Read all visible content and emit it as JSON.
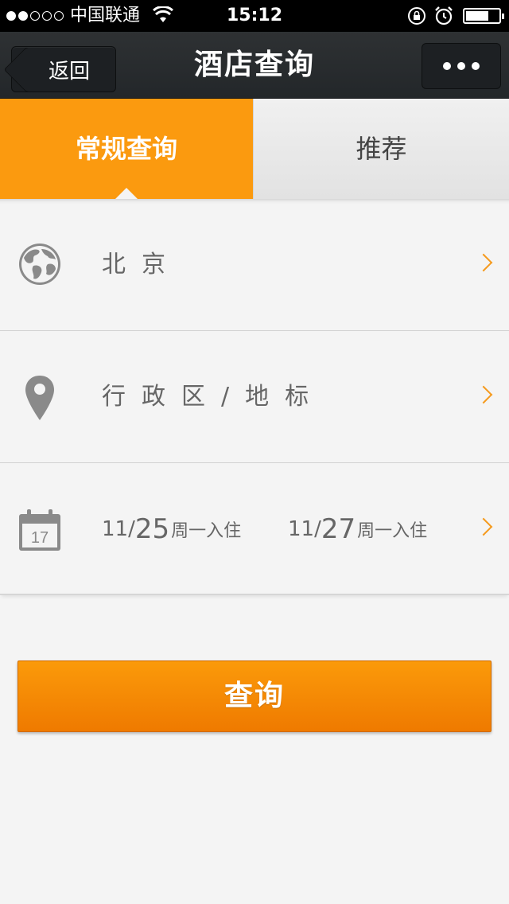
{
  "status_bar": {
    "carrier": "中国联通",
    "time": "15:12"
  },
  "nav": {
    "back_label": "返回",
    "title": "酒店查询"
  },
  "tabs": [
    {
      "label": "常规查询",
      "active": true
    },
    {
      "label": "推荐",
      "active": false
    }
  ],
  "form": {
    "city": "北京",
    "district": "行政区/地标",
    "checkin": {
      "month": "11/",
      "day": "25",
      "suffix": "周一入住"
    },
    "checkout": {
      "month": "11/",
      "day": "27",
      "suffix": "周一入住"
    },
    "calendar_day": "17"
  },
  "search_button": {
    "label": "查询"
  },
  "colors": {
    "accent": "#fb9a0f",
    "nav_bg": "#2a2d30",
    "chevron": "#f59a1d",
    "icon_gray": "#8a8a8a"
  }
}
